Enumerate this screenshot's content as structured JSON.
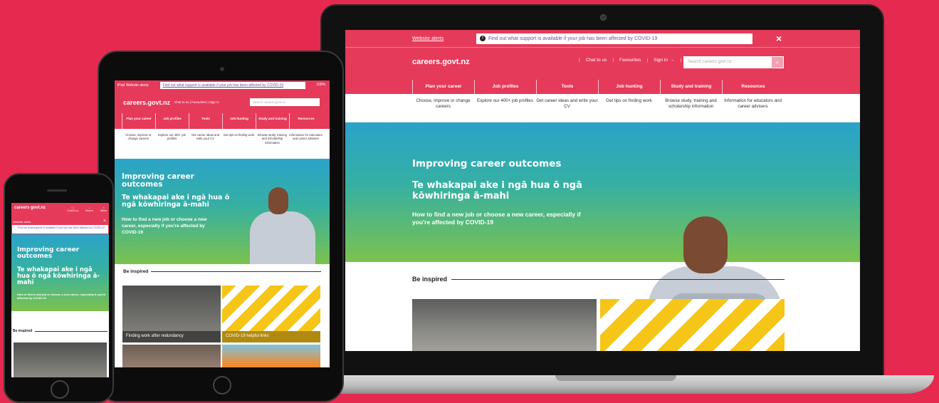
{
  "brand": {
    "accent": "#e63a5a",
    "background": "#e6294f"
  },
  "laptop": {
    "alert_link": "Website alerts",
    "alert_message": "Find out what support is available if your job has been affected by COVID-19",
    "close_icon": "×",
    "logo": "careers.govt.nz",
    "chat": "Chat to us",
    "favourites": "Favourites",
    "sign_in": "Sign in",
    "search_placeholder": "Search careers.govt.nz",
    "nav": [
      "Plan your career",
      "Job profiles",
      "Tools",
      "Job hunting",
      "Study and training",
      "Resources"
    ],
    "sub": [
      "Choose, improve or change careers",
      "Explore our 400+ job profiles",
      "Get career ideas and write your CV",
      "Get tips on finding work",
      "Browse study, training and scholarship information",
      "Information for educators and career advisers"
    ],
    "hero_title": "Improving career outcomes",
    "hero_maori": "Te whakapai ake i ngā hua ō ngā kōwhiringa ā-mahi",
    "hero_text": "How to find a new job or choose a new career, especially if you're affected by COVID-19",
    "inspired": "Be inspired"
  },
  "tablet": {
    "status": "iPad",
    "alert_link": "Website alerts",
    "alert_message": "Find out what support is available if your job has been affected by COVID-19",
    "battery": "100%",
    "logo": "careers.govt.nz",
    "util": "Chat to us  |  Favourites  |  Sign in",
    "search_placeholder": "Search careers.govt.nz",
    "nav": [
      "Plan your career",
      "Job profiles",
      "Tools",
      "Job hunting",
      "Study and training",
      "Resources"
    ],
    "sub": [
      "Choose, improve or change careers",
      "Explore our 400+ job profiles",
      "Get career ideas and write your CV",
      "Get tips on finding work",
      "Browse study, training and scholarship information",
      "Information for educators and career advisers"
    ],
    "hero_title": "Improving career outcomes",
    "hero_maori": "Te whakapai ake i ngā hua ō ngā kōwhiringa ā-mahi",
    "hero_text": "How to find a new job or choose a new career, especially if you're affected by COVID-19",
    "inspired": "Be inspired",
    "card1": "Finding work after redundancy",
    "card2": "COVID-19 helpful links"
  },
  "phone": {
    "logo": "careers govt.nz",
    "icons": [
      "Chat to us",
      "Search",
      "Menu"
    ],
    "alert_link": "Website alerts",
    "alert_message": "Find out what support is available if your job has been affected by COVID-19",
    "hero_title": "Improving career outcomes",
    "hero_maori": "Te whakapai ake i ngā hua ō ngā kōwhiringa ā-mahi",
    "hero_text": "How to find a new job or choose a new career, especially if you're affected by COVID-19",
    "inspired": "Be inspired"
  }
}
